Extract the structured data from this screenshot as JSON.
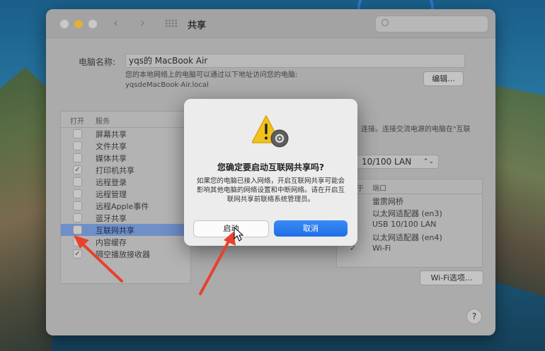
{
  "window": {
    "title": "共享"
  },
  "computer": {
    "label": "电脑名称:",
    "name": "yqs的 MacBook Air",
    "desc_line1": "您的本地网络上的电脑可以通过以下地址访问您的电脑:",
    "desc_line2": "yqsdeMacBook-Air.local",
    "edit_button": "编辑..."
  },
  "services": {
    "header_on": "打开",
    "header_service": "服务",
    "items": [
      {
        "label": "屏幕共享",
        "checked": false
      },
      {
        "label": "文件共享",
        "checked": false
      },
      {
        "label": "媒体共享",
        "checked": false
      },
      {
        "label": "打印机共享",
        "checked": true
      },
      {
        "label": "远程登录",
        "checked": false
      },
      {
        "label": "远程管理",
        "checked": false
      },
      {
        "label": "远程Apple事件",
        "checked": false
      },
      {
        "label": "蓝牙共享",
        "checked": false
      },
      {
        "label": "互联网共享",
        "checked": false,
        "selected": true
      },
      {
        "label": "内容缓存",
        "checked": false
      },
      {
        "label": "隔空播放接收器",
        "checked": true
      }
    ]
  },
  "internet_sharing": {
    "desc_part": "连接。连接交流电源的电脑在\"互联",
    "share_from": "10/100 LAN",
    "ports_header_to": "于",
    "ports_header_port": "端口",
    "ports": [
      {
        "label": "雷雳网桥",
        "checked": false
      },
      {
        "label": "以太网适配器 (en3)",
        "checked": false
      },
      {
        "label": "USB 10/100 LAN",
        "checked": false
      },
      {
        "label": "以太网适配器 (en4)",
        "checked": false
      },
      {
        "label": "Wi-Fi",
        "checked": true
      }
    ],
    "wifi_button": "Wi-Fi选项...",
    "help": "?"
  },
  "alert": {
    "title": "您确定要启动互联网共享吗?",
    "message": "如果您的电脑已接入网络，开启互联网共享可能会影响其他电脑的网络设置和中断网络。请在开启互联网共享前联络系统管理员。",
    "start_button": "启动",
    "cancel_button": "取消"
  },
  "colors": {
    "accent": "#1f6fe4",
    "selection": "#6f8fc8",
    "annotation_arrow": "#e8412c",
    "warning": "#f2c21b"
  }
}
